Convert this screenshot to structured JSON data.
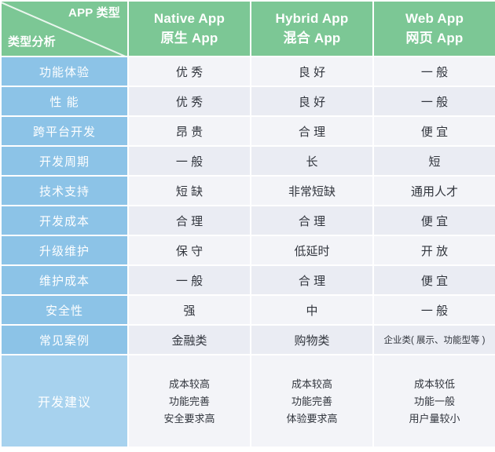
{
  "header": {
    "corner": {
      "top_right": "APP 类型",
      "bottom_left": "类型分析"
    },
    "columns": [
      {
        "en": "Native App",
        "cn": "原生 App"
      },
      {
        "en": "Hybrid App",
        "cn": "混合 App"
      },
      {
        "en": "Web App",
        "cn": "网页 App"
      }
    ]
  },
  "colors": {
    "header_green": "#7cc795",
    "label_blue": "#8cc3e7",
    "label_blue_light": "#a7d2ee",
    "cell_light": "#f3f4f8",
    "cell_dark": "#eaecf3",
    "text_dark": "#31353d",
    "text_white": "#ffffff"
  },
  "rows": [
    {
      "label": "功能体验",
      "values": [
        "优 秀",
        "良 好",
        "一 般"
      ]
    },
    {
      "label": "性 能",
      "values": [
        "优 秀",
        "良 好",
        "一 般"
      ]
    },
    {
      "label": "跨平台开发",
      "values": [
        "昂 贵",
        "合 理",
        "便 宜"
      ]
    },
    {
      "label": "开发周期",
      "values": [
        "一 般",
        "长",
        "短"
      ]
    },
    {
      "label": "技术支持",
      "values": [
        "短 缺",
        "非常短缺",
        "通用人才"
      ]
    },
    {
      "label": "开发成本",
      "values": [
        "合 理",
        "合 理",
        "便 宜"
      ]
    },
    {
      "label": "升级维护",
      "values": [
        "保 守",
        "低延时",
        "开 放"
      ]
    },
    {
      "label": "维护成本",
      "values": [
        "一 般",
        "合 理",
        "便 宜"
      ]
    },
    {
      "label": "安全性",
      "values": [
        "强",
        "中",
        "一 般"
      ]
    },
    {
      "label": "常见案例",
      "values": [
        "金融类",
        "购物类",
        "企业类( 展示、功能型等 )"
      ]
    }
  ],
  "advice": {
    "label": "开发建议",
    "columns": [
      [
        "成本较高",
        "功能完善",
        "安全要求高"
      ],
      [
        "成本较高",
        "功能完善",
        "体验要求高"
      ],
      [
        "成本较低",
        "功能一般",
        "用户量较小"
      ]
    ]
  }
}
